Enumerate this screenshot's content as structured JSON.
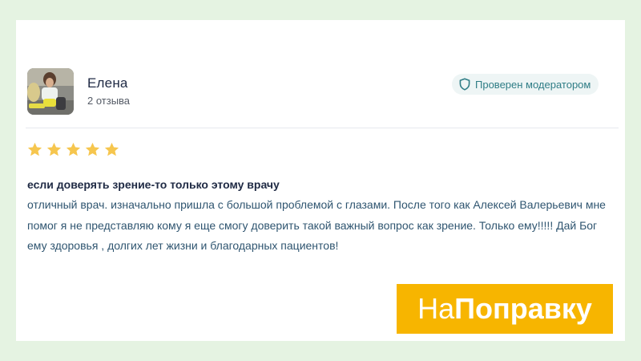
{
  "author": {
    "name": "Елена",
    "reviews_count": "2 отзыва",
    "avatar_icon": "user-photo"
  },
  "badge": {
    "icon": "shield-icon",
    "label": "Проверен модератором",
    "color": "#2f7d86"
  },
  "rating": {
    "stars": 5,
    "max": 5,
    "color": "#f6c64e"
  },
  "review": {
    "title": "если доверять зрение-то только этому врачу",
    "text": "отличный врач. изначально пришла с большой проблемой с глазами. После того как Алексей Валерьевич мне помог я не представляю кому я еще смогу доверить такой важный вопрос как зрение. Только ему!!!!! Дай Бог ему здоровья , долгих лет жизни и благодарных пациентов!"
  },
  "logo": {
    "part_light": "На",
    "part_bold": "Поправку",
    "background": "#f7b500"
  }
}
